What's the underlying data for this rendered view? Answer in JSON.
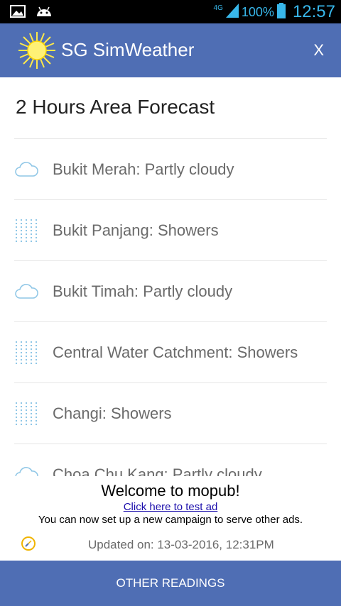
{
  "status_bar": {
    "network": "4G",
    "battery_percent": "100%",
    "time": "12:57",
    "left_icons": [
      "image-icon",
      "android-icon"
    ]
  },
  "app_bar": {
    "title": "SG SimWeather",
    "close_label": "X",
    "logo": "sun-icon"
  },
  "forecast": {
    "title": "2 Hours Area Forecast",
    "items": [
      {
        "label": "Bukit Merah: Partly cloudy",
        "icon": "cloud-icon"
      },
      {
        "label": "Bukit Panjang: Showers",
        "icon": "showers-icon"
      },
      {
        "label": "Bukit Timah: Partly cloudy",
        "icon": "cloud-icon"
      },
      {
        "label": "Central Water Catchment: Showers",
        "icon": "showers-icon"
      },
      {
        "label": "Changi: Showers",
        "icon": "showers-icon"
      },
      {
        "label": "Choa Chu Kang: Partly cloudy",
        "icon": "cloud-icon"
      }
    ]
  },
  "ad": {
    "title": "Welcome to mopub!",
    "link": "Click here to test ad",
    "body": "You can now set up a new campaign to serve other ads."
  },
  "updated": {
    "text": "Updated on: 13-03-2016, 12:31PM",
    "icon": "clock-icon"
  },
  "bottom_button": {
    "label": "OTHER READINGS"
  },
  "colors": {
    "accent": "#4f6eb4",
    "status_accent": "#38b7ea",
    "icon": "#8ec6e6"
  }
}
